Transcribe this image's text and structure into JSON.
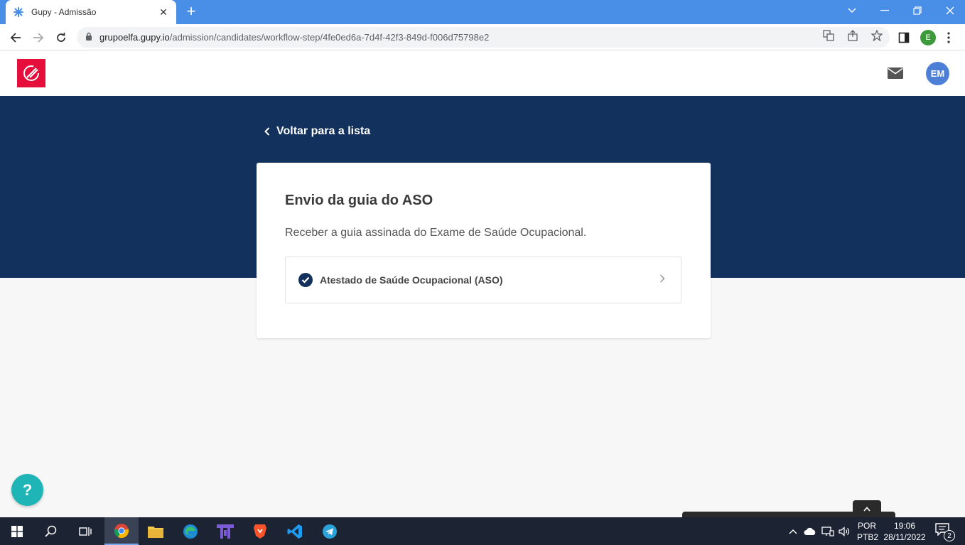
{
  "browser": {
    "tab_title": "Gupy - Admissão",
    "tab_close": "✕",
    "new_tab": "+",
    "url_domain": "grupoelfa.gupy.io",
    "url_path": "/admission/candidates/workflow-step/4fe0ed6a-7d4f-42f3-849d-f006d75798e2",
    "profile_initial": "E"
  },
  "header": {
    "avatar_initials": "EM"
  },
  "page": {
    "back_label": "Voltar para a lista",
    "card_title": "Envio da guia do ASO",
    "card_description": "Receber a guia assinada do Exame de Saúde Ocupacional.",
    "items": [
      {
        "label": "Atestado de Saúde Ocupacional (ASO)",
        "status": "completed"
      }
    ],
    "help_label": "?"
  },
  "taskbar": {
    "lang_line1": "POR",
    "lang_line2": "PTB2",
    "time": "19:06",
    "date": "28/11/2022",
    "notification_count": "2"
  },
  "colors": {
    "chrome_blue": "#4a8fe7",
    "hero_navy": "#12315c",
    "brand_red": "#e60f3c",
    "help_teal": "#1fb5b6",
    "avatar_blue": "#4d7fd6"
  }
}
